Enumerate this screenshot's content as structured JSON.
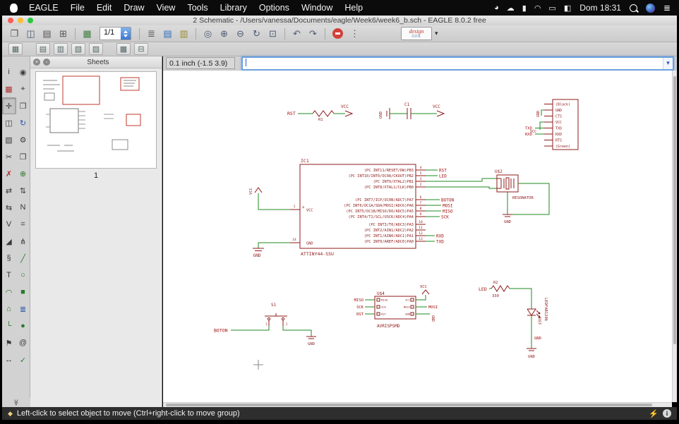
{
  "menubar": {
    "items": [
      "EAGLE",
      "File",
      "Edit",
      "Draw",
      "View",
      "Tools",
      "Library",
      "Options",
      "Window",
      "Help"
    ],
    "time": "Dom 18:31",
    "list_glyph": "≣",
    "status_icons": [
      {
        "name": "status-circle-icon",
        "glyph": "◕"
      },
      {
        "name": "cloud-icon",
        "glyph": "☁"
      },
      {
        "name": "battery-icon",
        "glyph": "▮"
      },
      {
        "name": "wifi-icon",
        "glyph": "◠"
      },
      {
        "name": "display-icon",
        "glyph": "▭"
      },
      {
        "name": "keyboard-icon",
        "glyph": "◧"
      }
    ]
  },
  "window": {
    "title": "2 Schematic - /Users/vanessa/Documents/eagle/Week6/week6_b.sch - EAGLE 8.0.2 free"
  },
  "toolbar": {
    "sheet_selector": "1/1",
    "glyphs": {
      "open": "❐",
      "save": "◫",
      "print": "▤",
      "export": "⊞",
      "grid": "▦",
      "layers": "≣",
      "schematic_view": "▤",
      "board_view": "▥",
      "zoom_fit": "◎",
      "zoom_in": "⊕",
      "zoom_out": "⊖",
      "zoom_redraw": "↻",
      "zoom_select": "⊡",
      "undo": "↶",
      "redo": "↷",
      "more": "⋮",
      "designlink_caret": "▾"
    },
    "designlink": {
      "line1": "design",
      "line2": "link"
    }
  },
  "toolbar2": {
    "glyphs": [
      "▦",
      "▤",
      "▥",
      "▧",
      "▨",
      "▩",
      "⊟"
    ]
  },
  "palette": {
    "overflow_glyph": "≫",
    "tools": [
      {
        "name": "info",
        "glyph": "i"
      },
      {
        "name": "show",
        "glyph": "◉"
      },
      {
        "name": "display",
        "glyph": "▦",
        "color": "#b03030"
      },
      {
        "name": "mark",
        "glyph": "⌖"
      },
      {
        "name": "move",
        "glyph": "✛",
        "active": true
      },
      {
        "name": "copy",
        "glyph": "❐"
      },
      {
        "name": "mirror",
        "glyph": "◫"
      },
      {
        "name": "rotate",
        "glyph": "↻",
        "color": "#2a58a8"
      },
      {
        "name": "group",
        "glyph": "▧"
      },
      {
        "name": "change",
        "glyph": "⚙"
      },
      {
        "name": "cut",
        "glyph": "✂"
      },
      {
        "name": "paste",
        "glyph": "❒"
      },
      {
        "name": "delete",
        "glyph": "✗",
        "color": "#b03030"
      },
      {
        "name": "add",
        "glyph": "⊕",
        "color": "#2a7a2a"
      },
      {
        "name": "pinswap",
        "glyph": "⇄"
      },
      {
        "name": "gateswap",
        "glyph": "⇅"
      },
      {
        "name": "replace",
        "glyph": "⇆"
      },
      {
        "name": "name",
        "glyph": "N"
      },
      {
        "name": "value",
        "glyph": "V"
      },
      {
        "name": "smash",
        "glyph": "⌗"
      },
      {
        "name": "miter",
        "glyph": "◢"
      },
      {
        "name": "split",
        "glyph": "⋔"
      },
      {
        "name": "invoke",
        "glyph": "§"
      },
      {
        "name": "wire",
        "glyph": "╱",
        "color": "#2a7a2a"
      },
      {
        "name": "text",
        "glyph": "T"
      },
      {
        "name": "circle",
        "glyph": "○",
        "color": "#2a7a2a"
      },
      {
        "name": "arc",
        "glyph": "◠",
        "color": "#2a7a2a"
      },
      {
        "name": "rect",
        "glyph": "■",
        "color": "#2a7a2a"
      },
      {
        "name": "polygon",
        "glyph": "⌂",
        "color": "#2a7a2a"
      },
      {
        "name": "bus",
        "glyph": "≣",
        "color": "#2a58a8"
      },
      {
        "name": "net",
        "glyph": "└",
        "color": "#2a7a2a"
      },
      {
        "name": "junction",
        "glyph": "●",
        "color": "#2a7a2a"
      },
      {
        "name": "label",
        "glyph": "⚑"
      },
      {
        "name": "attribute",
        "glyph": "@"
      },
      {
        "name": "dimension",
        "glyph": "↔"
      },
      {
        "name": "erc",
        "glyph": "✓",
        "color": "#2e7d32"
      }
    ]
  },
  "sheets": {
    "title": "Sheets",
    "page": "1",
    "close_glyph": "×",
    "float_glyph": "◦"
  },
  "coordbar": {
    "coordinates": "0.1 inch (-1.5 3.9)",
    "command_value": "",
    "drop_glyph": "▾"
  },
  "statusbar": {
    "mode_icon": "◆",
    "text": "Left-click to select object to move (Ctrl+right-click to move group)",
    "lightning": "⚡",
    "info": "i"
  },
  "schematic": {
    "vcc": "VCC",
    "gnd": "GND",
    "plus": "+",
    "nets": {
      "rst": "RST",
      "led": "LED",
      "boton": "BOTON",
      "mosi": "MOSI",
      "miso": "MISO",
      "sck": "SCK",
      "rxd": "RXD",
      "txd": "TXD"
    },
    "r1": {
      "name": "R1"
    },
    "c1": {
      "name": "C1"
    },
    "connector": {
      "pins": [
        "(Black)",
        "GND",
        "CTS",
        "VCC",
        "TXD",
        "RXD",
        "RTS",
        "(Green)"
      ]
    },
    "ic1": {
      "name": "IC1",
      "value": "ATTINY44-SSU",
      "left_pins": [
        {
          "num": "1",
          "label": "VCC"
        },
        {
          "num": "14",
          "label": "GND"
        }
      ],
      "right_pins": [
        {
          "num": "4",
          "label": "(PC INT11/RESET/DW)PB3",
          "net": "RST"
        },
        {
          "num": "5",
          "label": "(PC INT10/INT0/OC0A/CKOUT)PB2",
          "net": "LED"
        },
        {
          "num": "3",
          "label": "(PC INT9/XTAL2)PB1",
          "net": ""
        },
        {
          "num": "2",
          "label": "(PC INT8/XTAL1/CLK)PB0",
          "net": ""
        },
        {
          "num": "6",
          "label": "(PC INT7/ICP/OC0B/ADC7)PA7",
          "net": "BOTON"
        },
        {
          "num": "7",
          "label": "(PC INT6/OC1A/SDA/MOSI/ADC6)PA6",
          "net": "MOSI"
        },
        {
          "num": "8",
          "label": "(PC INT5/OC1B/MISO/DO/ADC5)PA5",
          "net": "MISO"
        },
        {
          "num": "9",
          "label": "(PC INT4/T1/SCL/USCK/ADC4)PA4",
          "net": "SCK"
        },
        {
          "num": "10",
          "label": "(PC INT3/T0/ADC3)PA3",
          "net": ""
        },
        {
          "num": "11",
          "label": "(PC INT2/AIN1/ADC2)PA2",
          "net": ""
        },
        {
          "num": "12",
          "label": "(PC INT1/AIN0/ADC1)PA1",
          "net": "RXD"
        },
        {
          "num": "13",
          "label": "(PC INT0/AREF/ADC0)PA0",
          "net": "TXD"
        }
      ]
    },
    "resonator": {
      "name": "U$2",
      "value": "RESONATOR"
    },
    "s1": {
      "name": "S1",
      "pin1": "1",
      "pin2": "2"
    },
    "avrisp": {
      "name": "U$4",
      "value": "AVRISPSMD",
      "inner": [
        "MISO",
        "VCC",
        "SCK",
        "MOSI",
        "RST",
        "GND"
      ]
    },
    "led": {
      "r_name": "R2",
      "r_value": "330",
      "u_name": "U$3",
      "u_value": "LEDFAB1206"
    }
  }
}
